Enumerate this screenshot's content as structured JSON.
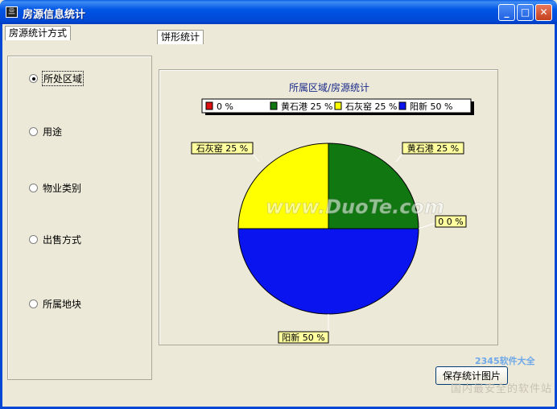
{
  "window": {
    "title": "房源信息统计",
    "app_icon": "app-icon",
    "min": "_",
    "max": "□",
    "close": "✕"
  },
  "tabs": {
    "left": "房源统计方式",
    "right": "饼形统计"
  },
  "options": [
    {
      "label": "所处区域",
      "selected": true
    },
    {
      "label": "用途",
      "selected": false
    },
    {
      "label": "物业类别",
      "selected": false
    },
    {
      "label": "出售方式",
      "selected": false
    },
    {
      "label": "所属地块",
      "selected": false
    }
  ],
  "chart_data": {
    "type": "pie",
    "title": "所属区域/房源统计",
    "legend_position": "top",
    "slices": [
      {
        "name": "",
        "value": 0,
        "label": "0 %",
        "callout": "0 0 %",
        "color": "#dd1111"
      },
      {
        "name": "黄石港",
        "value": 25,
        "label": "25 %",
        "callout": "黄石港 25 %",
        "color": "#117711"
      },
      {
        "name": "石灰窑",
        "value": 25,
        "label": "25 %",
        "callout": "石灰窑 25 %",
        "color": "#ffff00"
      },
      {
        "name": "阳新",
        "value": 50,
        "label": "50 %",
        "callout": "阳新 50 %",
        "color": "#0a14ee"
      }
    ],
    "watermark": "www.DuoTe.com"
  },
  "save_button": "保存统计图片",
  "watermarks": {
    "logo": "2345软件大全",
    "bottom": "国内最安全的软件站"
  }
}
